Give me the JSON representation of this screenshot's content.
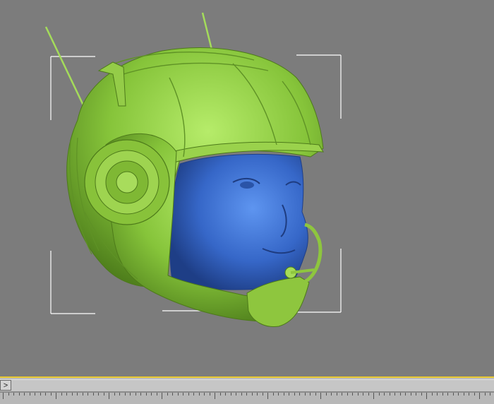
{
  "viewport": {
    "background": "#7c7c7c",
    "helmet_color": "#8cc83a",
    "face_color": "#3a6fd0",
    "selection_bracket_color": "#ffffff",
    "active_border_color": "#e8c830"
  },
  "timeline": {
    "arrow_label": ">",
    "arrow_icon": "chevron-right-icon"
  }
}
